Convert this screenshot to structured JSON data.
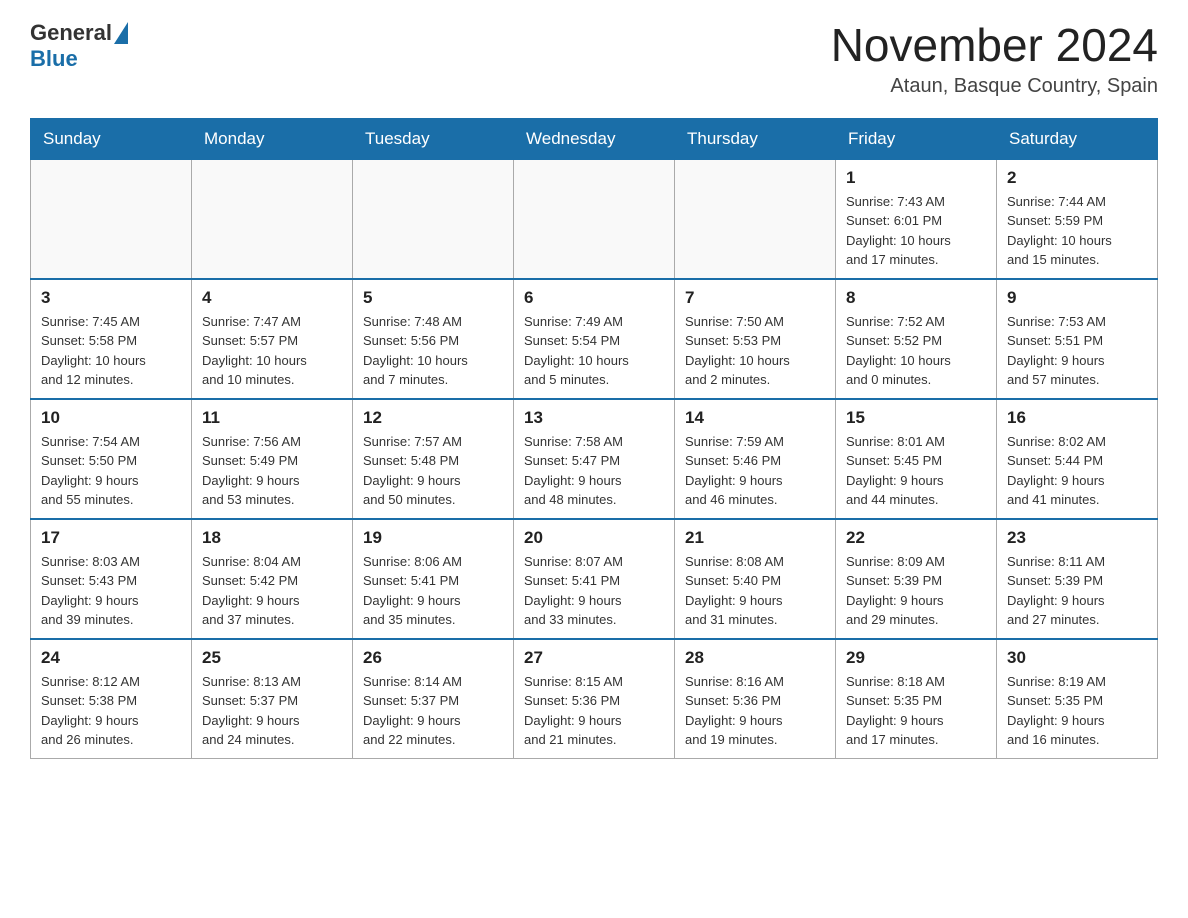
{
  "header": {
    "logo": {
      "text_general": "General",
      "text_blue": "Blue"
    },
    "title": "November 2024",
    "location": "Ataun, Basque Country, Spain"
  },
  "days_of_week": [
    "Sunday",
    "Monday",
    "Tuesday",
    "Wednesday",
    "Thursday",
    "Friday",
    "Saturday"
  ],
  "weeks": [
    {
      "days": [
        {
          "number": "",
          "info": ""
        },
        {
          "number": "",
          "info": ""
        },
        {
          "number": "",
          "info": ""
        },
        {
          "number": "",
          "info": ""
        },
        {
          "number": "",
          "info": ""
        },
        {
          "number": "1",
          "info": "Sunrise: 7:43 AM\nSunset: 6:01 PM\nDaylight: 10 hours\nand 17 minutes."
        },
        {
          "number": "2",
          "info": "Sunrise: 7:44 AM\nSunset: 5:59 PM\nDaylight: 10 hours\nand 15 minutes."
        }
      ]
    },
    {
      "days": [
        {
          "number": "3",
          "info": "Sunrise: 7:45 AM\nSunset: 5:58 PM\nDaylight: 10 hours\nand 12 minutes."
        },
        {
          "number": "4",
          "info": "Sunrise: 7:47 AM\nSunset: 5:57 PM\nDaylight: 10 hours\nand 10 minutes."
        },
        {
          "number": "5",
          "info": "Sunrise: 7:48 AM\nSunset: 5:56 PM\nDaylight: 10 hours\nand 7 minutes."
        },
        {
          "number": "6",
          "info": "Sunrise: 7:49 AM\nSunset: 5:54 PM\nDaylight: 10 hours\nand 5 minutes."
        },
        {
          "number": "7",
          "info": "Sunrise: 7:50 AM\nSunset: 5:53 PM\nDaylight: 10 hours\nand 2 minutes."
        },
        {
          "number": "8",
          "info": "Sunrise: 7:52 AM\nSunset: 5:52 PM\nDaylight: 10 hours\nand 0 minutes."
        },
        {
          "number": "9",
          "info": "Sunrise: 7:53 AM\nSunset: 5:51 PM\nDaylight: 9 hours\nand 57 minutes."
        }
      ]
    },
    {
      "days": [
        {
          "number": "10",
          "info": "Sunrise: 7:54 AM\nSunset: 5:50 PM\nDaylight: 9 hours\nand 55 minutes."
        },
        {
          "number": "11",
          "info": "Sunrise: 7:56 AM\nSunset: 5:49 PM\nDaylight: 9 hours\nand 53 minutes."
        },
        {
          "number": "12",
          "info": "Sunrise: 7:57 AM\nSunset: 5:48 PM\nDaylight: 9 hours\nand 50 minutes."
        },
        {
          "number": "13",
          "info": "Sunrise: 7:58 AM\nSunset: 5:47 PM\nDaylight: 9 hours\nand 48 minutes."
        },
        {
          "number": "14",
          "info": "Sunrise: 7:59 AM\nSunset: 5:46 PM\nDaylight: 9 hours\nand 46 minutes."
        },
        {
          "number": "15",
          "info": "Sunrise: 8:01 AM\nSunset: 5:45 PM\nDaylight: 9 hours\nand 44 minutes."
        },
        {
          "number": "16",
          "info": "Sunrise: 8:02 AM\nSunset: 5:44 PM\nDaylight: 9 hours\nand 41 minutes."
        }
      ]
    },
    {
      "days": [
        {
          "number": "17",
          "info": "Sunrise: 8:03 AM\nSunset: 5:43 PM\nDaylight: 9 hours\nand 39 minutes."
        },
        {
          "number": "18",
          "info": "Sunrise: 8:04 AM\nSunset: 5:42 PM\nDaylight: 9 hours\nand 37 minutes."
        },
        {
          "number": "19",
          "info": "Sunrise: 8:06 AM\nSunset: 5:41 PM\nDaylight: 9 hours\nand 35 minutes."
        },
        {
          "number": "20",
          "info": "Sunrise: 8:07 AM\nSunset: 5:41 PM\nDaylight: 9 hours\nand 33 minutes."
        },
        {
          "number": "21",
          "info": "Sunrise: 8:08 AM\nSunset: 5:40 PM\nDaylight: 9 hours\nand 31 minutes."
        },
        {
          "number": "22",
          "info": "Sunrise: 8:09 AM\nSunset: 5:39 PM\nDaylight: 9 hours\nand 29 minutes."
        },
        {
          "number": "23",
          "info": "Sunrise: 8:11 AM\nSunset: 5:39 PM\nDaylight: 9 hours\nand 27 minutes."
        }
      ]
    },
    {
      "days": [
        {
          "number": "24",
          "info": "Sunrise: 8:12 AM\nSunset: 5:38 PM\nDaylight: 9 hours\nand 26 minutes."
        },
        {
          "number": "25",
          "info": "Sunrise: 8:13 AM\nSunset: 5:37 PM\nDaylight: 9 hours\nand 24 minutes."
        },
        {
          "number": "26",
          "info": "Sunrise: 8:14 AM\nSunset: 5:37 PM\nDaylight: 9 hours\nand 22 minutes."
        },
        {
          "number": "27",
          "info": "Sunrise: 8:15 AM\nSunset: 5:36 PM\nDaylight: 9 hours\nand 21 minutes."
        },
        {
          "number": "28",
          "info": "Sunrise: 8:16 AM\nSunset: 5:36 PM\nDaylight: 9 hours\nand 19 minutes."
        },
        {
          "number": "29",
          "info": "Sunrise: 8:18 AM\nSunset: 5:35 PM\nDaylight: 9 hours\nand 17 minutes."
        },
        {
          "number": "30",
          "info": "Sunrise: 8:19 AM\nSunset: 5:35 PM\nDaylight: 9 hours\nand 16 minutes."
        }
      ]
    }
  ]
}
